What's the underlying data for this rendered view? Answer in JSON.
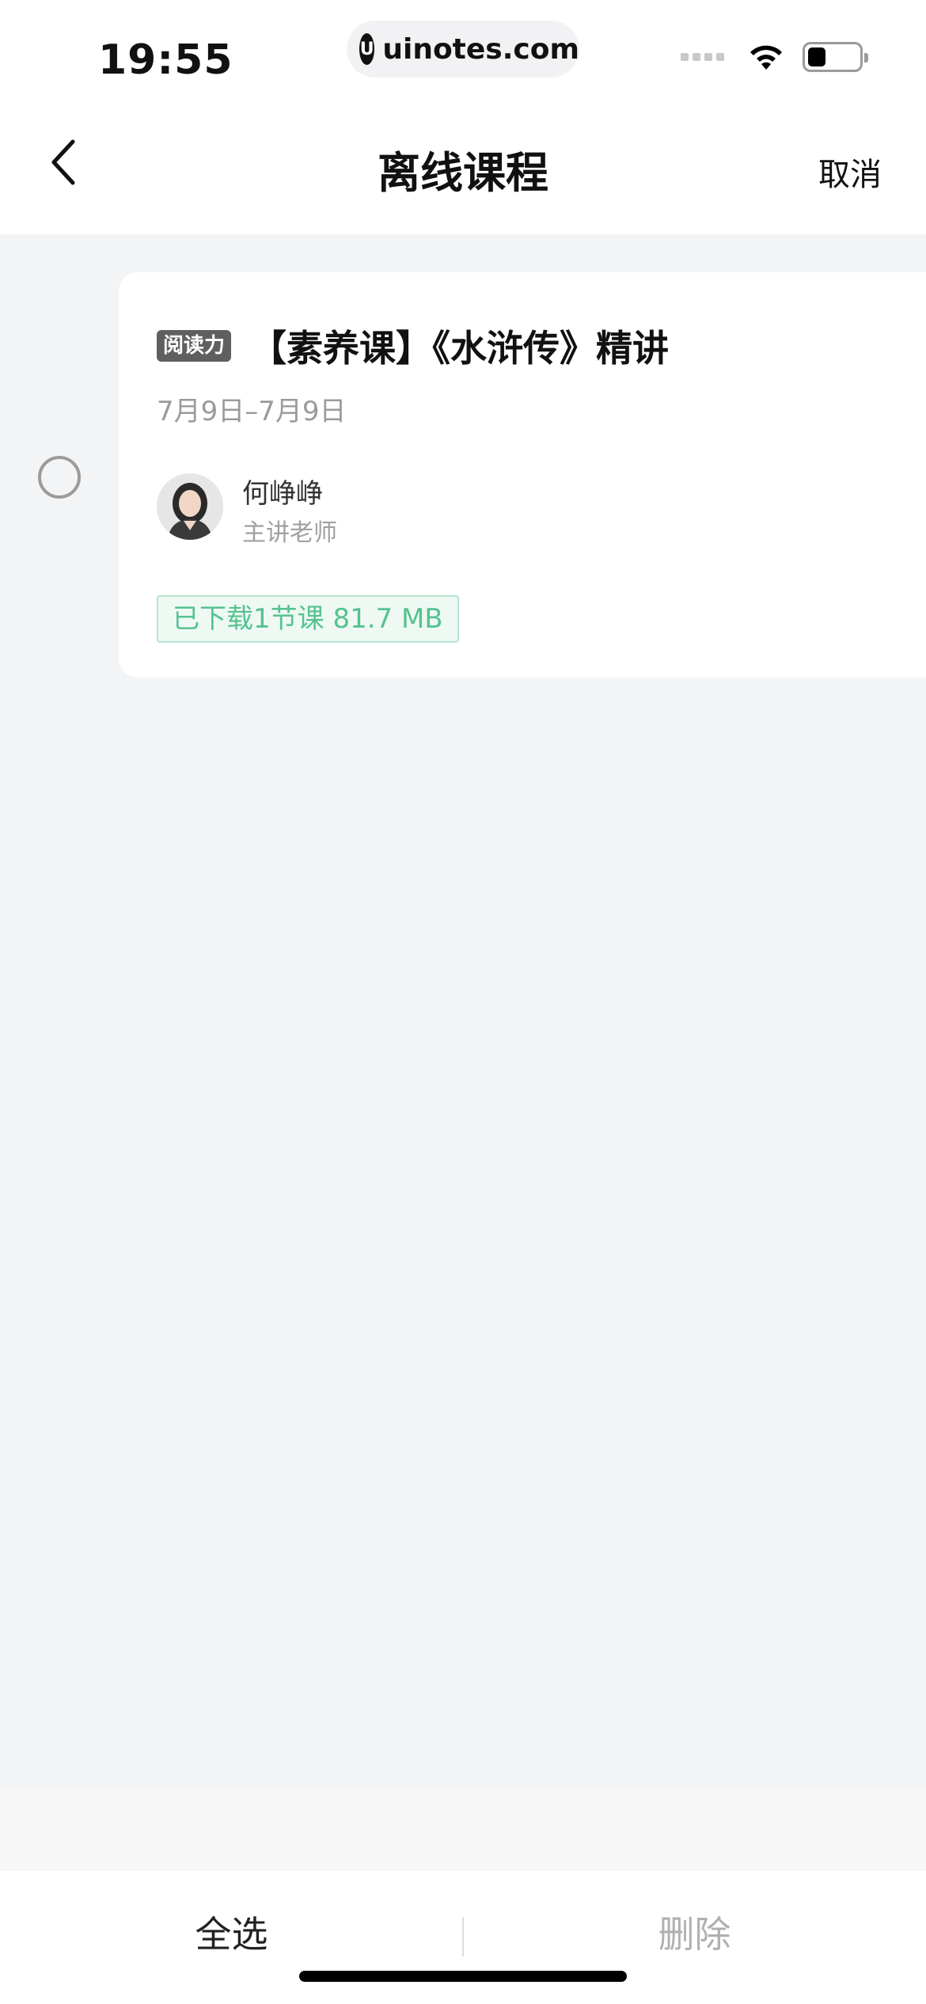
{
  "status_bar": {
    "time": "19:55",
    "url": "uinotes.com",
    "url_logo": "U"
  },
  "nav": {
    "title": "离线课程",
    "cancel_label": "取消"
  },
  "course": {
    "tag": "阅读力",
    "title": "【素养课】《水浒传》精讲",
    "date_range": "7月9日–7月9日",
    "teacher_name": "何峥峥",
    "teacher_role": "主讲老师",
    "download_info": "已下载1节课 81.7 MB"
  },
  "bottom_bar": {
    "select_all_label": "全选",
    "delete_label": "删除"
  },
  "colors": {
    "background": "#f3f4f6",
    "download_text": "#56c28f",
    "download_border": "#b7e4cf",
    "tag_bg": "#5f5f5f"
  }
}
